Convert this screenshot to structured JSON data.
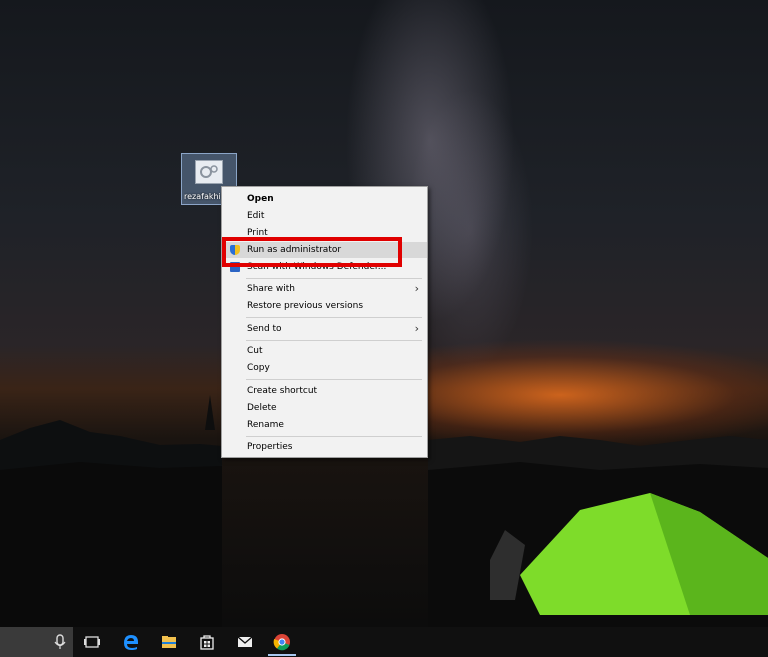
{
  "desktop": {
    "icon_label": "rezafakhi"
  },
  "context_menu": {
    "items": [
      {
        "label": "Open",
        "bold": true
      },
      {
        "label": "Edit"
      },
      {
        "label": "Print"
      },
      {
        "label": "Run as administrator",
        "icon": "shield-icon",
        "highlighted": true
      },
      {
        "label": "Scan with Windows Defender...",
        "icon": "windows-defender-icon"
      },
      {
        "label": "Share with",
        "submenu": true
      },
      {
        "label": "Restore previous versions"
      },
      {
        "label": "Send to",
        "submenu": true
      },
      {
        "label": "Cut"
      },
      {
        "label": "Copy"
      },
      {
        "label": "Create shortcut"
      },
      {
        "label": "Delete"
      },
      {
        "label": "Rename"
      },
      {
        "label": "Properties"
      }
    ],
    "submenu_arrow": "›"
  },
  "annotation": {
    "highlight_color": "#e00000"
  },
  "taskbar": {
    "icons": [
      "microphone-icon",
      "task-view-icon",
      "edge-icon",
      "file-explorer-icon",
      "store-icon",
      "mail-icon",
      "chrome-icon"
    ]
  },
  "colors": {
    "menu_bg": "#f2f2f2",
    "taskbar_bg": "#101010",
    "tent_green": "#7edc2a"
  }
}
